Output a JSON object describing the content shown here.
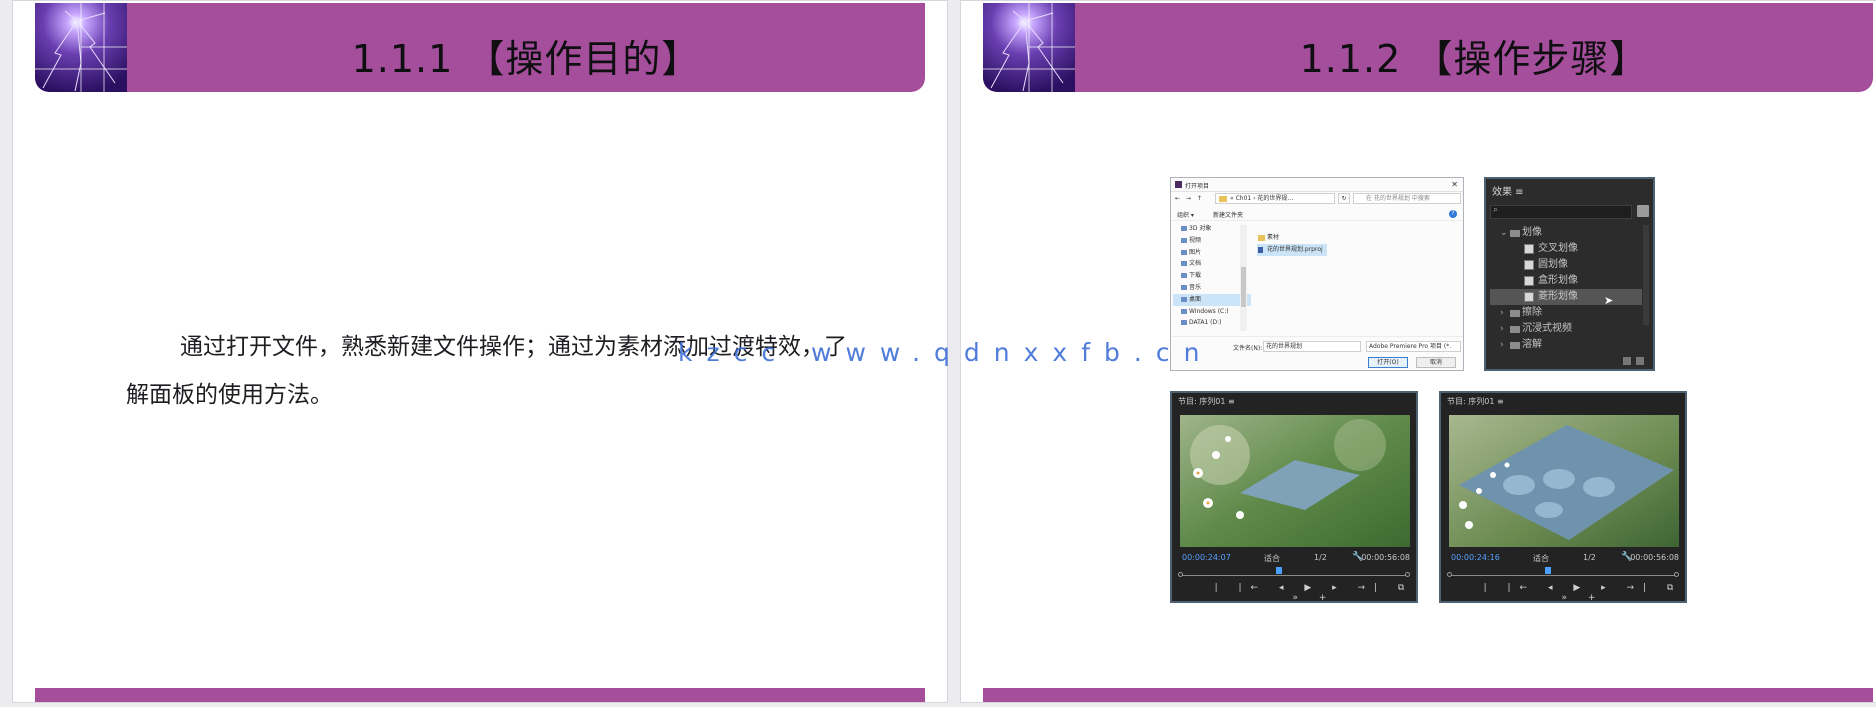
{
  "slide1": {
    "title": "1.1.1 【操作目的】",
    "body": "通过打开文件，熟悉新建文件操作；通过为素材添加过渡特效，了解面板的使用方法。"
  },
  "slide2": {
    "title": "1.1.2 【操作步骤】",
    "file_dialog": {
      "title": "打开项目",
      "close": "✕",
      "nav_arrows": "← → ↑",
      "path": "« Ch01 › 花的世界规…",
      "refresh": "↻",
      "search_placeholder": "在 花的世界规划 中搜索",
      "organize": "组织 ▾",
      "new_folder": "新建文件夹",
      "help": "?",
      "tree_items": [
        "3D 对象",
        "视频",
        "图片",
        "文档",
        "下载",
        "音乐",
        "桌面",
        "Windows (C:)",
        "DATA1 (D:)"
      ],
      "files": [
        "素材",
        "花的世界规划.prproj"
      ],
      "filename_label": "文件名(N):",
      "filename_value": "花的世界规划",
      "filetype_value": "Adobe Premiere Pro 项目 (*.",
      "open_button": "打开(O)",
      "cancel_button": "取消"
    },
    "effects_panel": {
      "title": "效果 ≡",
      "search_icon_glyph": "⌕",
      "rows": [
        {
          "type": "folder",
          "arrow": "⌄",
          "label": "划像"
        },
        {
          "type": "item",
          "label": "交叉划像"
        },
        {
          "type": "item",
          "label": "圆划像"
        },
        {
          "type": "item",
          "label": "盒形划像"
        },
        {
          "type": "item",
          "label": "菱形划像",
          "highlighted": true
        },
        {
          "type": "folder",
          "arrow": "›",
          "label": "擦除"
        },
        {
          "type": "folder",
          "arrow": "›",
          "label": "沉浸式视频"
        },
        {
          "type": "folder",
          "arrow": "›",
          "label": "溶解"
        }
      ]
    },
    "monitors": [
      {
        "header": "节目: 序列01 ≡",
        "timecode": "00:00:24:07",
        "fit": "适合",
        "resolution": "1/2",
        "duration": "00:00:56:08",
        "wrench": "🔧",
        "transport": "| |← ◂ ▶ ▸ →| ⧉ » +"
      },
      {
        "header": "节目: 序列01 ≡",
        "timecode": "00:00:24:16",
        "fit": "适合",
        "resolution": "1/2",
        "duration": "00:00:56:08",
        "wrench": "🔧",
        "transport": "| |← ◂ ▶ ▸ →| ⧉ » +"
      }
    ]
  },
  "watermark": "kzcc www.qdnxxfb.cn",
  "colors": {
    "header_purple": "#a54e9b",
    "watermark_blue": "#3e6fd8",
    "timecode_blue": "#57a0ff"
  }
}
